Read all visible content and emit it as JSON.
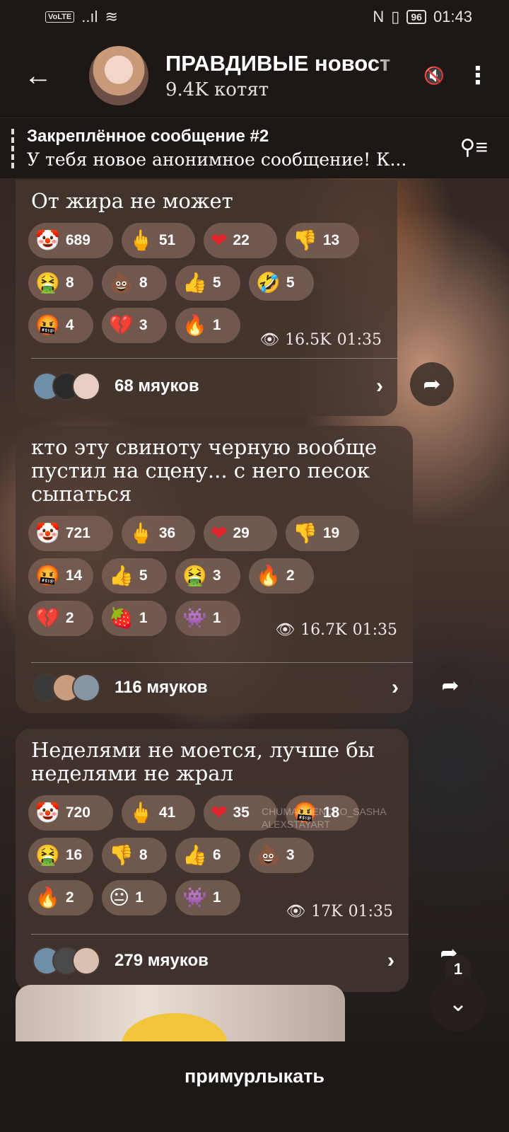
{
  "status_bar": {
    "volte": "VoLTE",
    "signal": "..ıl",
    "wifi": "≋",
    "nfc": "N",
    "vibrate": "▯",
    "battery": "96",
    "time": "01:43"
  },
  "header": {
    "title": "ПРАВДИВЫЕ новост",
    "subtitle": "9.4K котят"
  },
  "pinned": {
    "title": "Закреплённое сообщение #2",
    "body": "У тебя новое анонимное сообщение!  К..."
  },
  "messages": [
    {
      "text": "От жира не может",
      "reactions": [
        {
          "emoji": "🤡",
          "count": "689"
        },
        {
          "emoji": "🖕",
          "count": "51"
        },
        {
          "emoji": "❤",
          "count": "22"
        },
        {
          "emoji": "👎",
          "count": "13"
        },
        {
          "emoji": "🤮",
          "count": "8"
        },
        {
          "emoji": "💩",
          "count": "8"
        },
        {
          "emoji": "👍",
          "count": "5"
        },
        {
          "emoji": "🤣",
          "count": "5"
        },
        {
          "emoji": "🤬",
          "count": "4"
        },
        {
          "emoji": "💔",
          "count": "3"
        },
        {
          "emoji": "🔥",
          "count": "1"
        }
      ],
      "views": "16.5K",
      "time": "01:35",
      "comments": "68 мяуков"
    },
    {
      "text": "кто эту свиноту черную вообще пустил на сцену... с него песок сыпаться",
      "reactions": [
        {
          "emoji": "🤡",
          "count": "721"
        },
        {
          "emoji": "🖕",
          "count": "36"
        },
        {
          "emoji": "❤",
          "count": "29"
        },
        {
          "emoji": "👎",
          "count": "19"
        },
        {
          "emoji": "🤬",
          "count": "14"
        },
        {
          "emoji": "👍",
          "count": "5"
        },
        {
          "emoji": "🤮",
          "count": "3"
        },
        {
          "emoji": "🔥",
          "count": "2"
        },
        {
          "emoji": "💔",
          "count": "2"
        },
        {
          "emoji": "🍓",
          "count": "1"
        },
        {
          "emoji": "👾",
          "count": "1"
        }
      ],
      "views": "16.7K",
      "time": "01:35",
      "comments": "116 мяуков"
    },
    {
      "text": "Неделями не моется, лучше бы неделями не жрал",
      "reactions": [
        {
          "emoji": "🤡",
          "count": "720"
        },
        {
          "emoji": "🖕",
          "count": "41"
        },
        {
          "emoji": "❤",
          "count": "35"
        },
        {
          "emoji": "🤬",
          "count": "18"
        },
        {
          "emoji": "🤮",
          "count": "16"
        },
        {
          "emoji": "👎",
          "count": "8"
        },
        {
          "emoji": "👍",
          "count": "6"
        },
        {
          "emoji": "💩",
          "count": "3"
        },
        {
          "emoji": "🔥",
          "count": "2"
        },
        {
          "emoji": "😐",
          "count": "1"
        },
        {
          "emoji": "👾",
          "count": "1"
        }
      ],
      "views": "17K",
      "time": "01:35",
      "comments": "279 мяуков"
    }
  ],
  "watermark": {
    "line1": "CHUMACHENCKO_SASHA",
    "line2": "ALEXSTAYART"
  },
  "unread_count": "1",
  "bottom": {
    "join_label": "примурлыкать"
  },
  "icons": {
    "back": "←",
    "mute": "🔇",
    "menu": "⋮",
    "pin_list": "⚲≡",
    "eye": "👁",
    "chevron": "›",
    "share": "➦",
    "scroll_down": "⌄"
  }
}
